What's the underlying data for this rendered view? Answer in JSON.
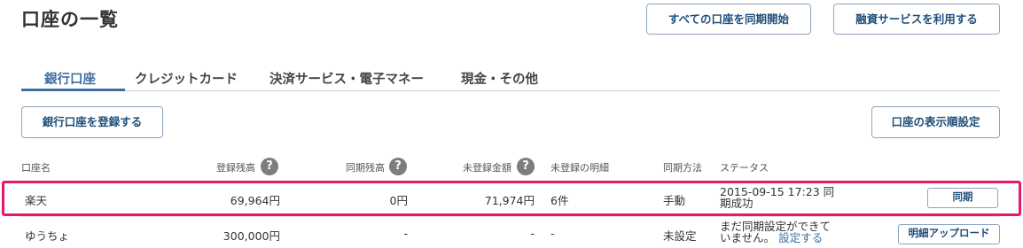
{
  "page": {
    "title": "口座の一覧"
  },
  "toolbar": {
    "sync_all_label": "すべての口座を同期開始",
    "finance_label": "融資サービスを利用する"
  },
  "tabs": [
    {
      "label": "銀行口座",
      "active": true
    },
    {
      "label": "クレジットカード",
      "active": false
    },
    {
      "label": "決済サービス・電子マネー",
      "active": false
    },
    {
      "label": "現金・その他",
      "active": false
    }
  ],
  "actions": {
    "register_label": "銀行口座を登録する",
    "order_label": "口座の表示順設定"
  },
  "table": {
    "headers": {
      "account_name": "口座名",
      "registered_balance": "登録残高",
      "synced_balance": "同期残高",
      "unregistered_amount": "未登録金額",
      "unregistered_details": "未登録の明細",
      "sync_method": "同期方法",
      "status": "ステータス"
    },
    "help_icon": "?",
    "rows": [
      {
        "name": "楽天",
        "registered_balance": "69,964円",
        "synced_balance": "0円",
        "unregistered_amount": "71,974円",
        "unregistered_details": "6件",
        "sync_method": "手動",
        "status_line1": "2015-09-15 17:23 同",
        "status_line2": "期成功",
        "status_link": "",
        "action_label": "同期"
      },
      {
        "name": "ゆうちょ",
        "registered_balance": "300,000円",
        "synced_balance": "-",
        "unregistered_amount": "-",
        "unregistered_details": "-",
        "sync_method": "未設定",
        "status_line1": "まだ同期設定ができて",
        "status_line2": "いません。",
        "status_link": "設定する",
        "action_label": "明細アップロード"
      }
    ]
  },
  "colors": {
    "accent": "#3f6ea3",
    "button_text": "#1f4e79",
    "highlight_border": "#e5186a",
    "help_icon_bg": "#7d7d7d"
  },
  "icons": {
    "help": "question-circle-icon"
  }
}
